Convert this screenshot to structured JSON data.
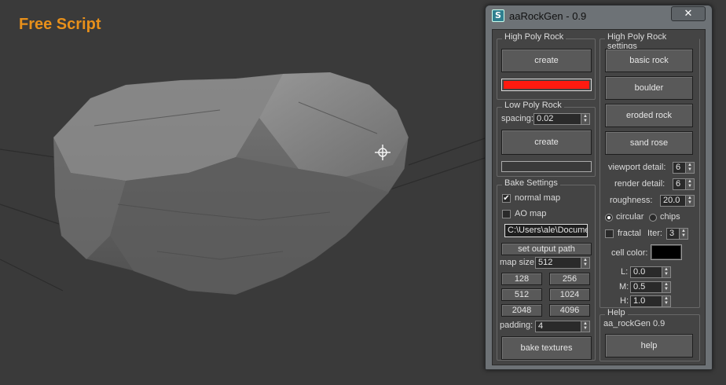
{
  "overlay_label": "Free Script",
  "window": {
    "title": "aaRockGen - 0.9",
    "close_glyph": "✕",
    "icon": "3dsmax-app-icon"
  },
  "high_poly": {
    "title": "High Poly Rock",
    "create_label": "create",
    "color": "#ff1a10"
  },
  "low_poly": {
    "title": "Low Poly Rock",
    "spacing_label": "spacing:",
    "spacing_value": "0.02",
    "create_label": "create"
  },
  "bake": {
    "title": "Bake Settings",
    "normal_map_label": "normal map",
    "normal_map_checked": true,
    "ao_map_label": "AO map",
    "ao_map_checked": false,
    "output_path": "C:\\Users\\ale\\Documen",
    "set_output_label": "set output path",
    "map_size_label": "map size:",
    "map_size_value": "512",
    "sizes": [
      "128",
      "256",
      "512",
      "1024",
      "2048",
      "4096"
    ],
    "padding_label": "padding:",
    "padding_value": "4",
    "bake_label": "bake textures"
  },
  "hp_settings": {
    "title": "High Poly Rock settings",
    "presets": [
      "basic rock",
      "boulder",
      "eroded rock",
      "sand rose"
    ],
    "viewport_detail_label": "viewport detail:",
    "viewport_detail_value": "6",
    "render_detail_label": "render detail:",
    "render_detail_value": "6",
    "roughness_label": "roughness:",
    "roughness_value": "20.0",
    "circular_label": "circular",
    "circular_selected": true,
    "chips_label": "chips",
    "chips_selected": false,
    "fractal_label": "fractal",
    "fractal_checked": false,
    "iter_label": "Iter:",
    "iter_value": "3",
    "cell_color_label": "cell color:",
    "cell_color": "#000000",
    "l_label": "L:",
    "l_value": "0.0",
    "m_label": "M:",
    "m_value": "0.5",
    "h_label": "H:",
    "h_value": "1.0"
  },
  "help": {
    "title": "Help",
    "version_text": "aa_rockGen 0.9",
    "help_label": "help"
  }
}
